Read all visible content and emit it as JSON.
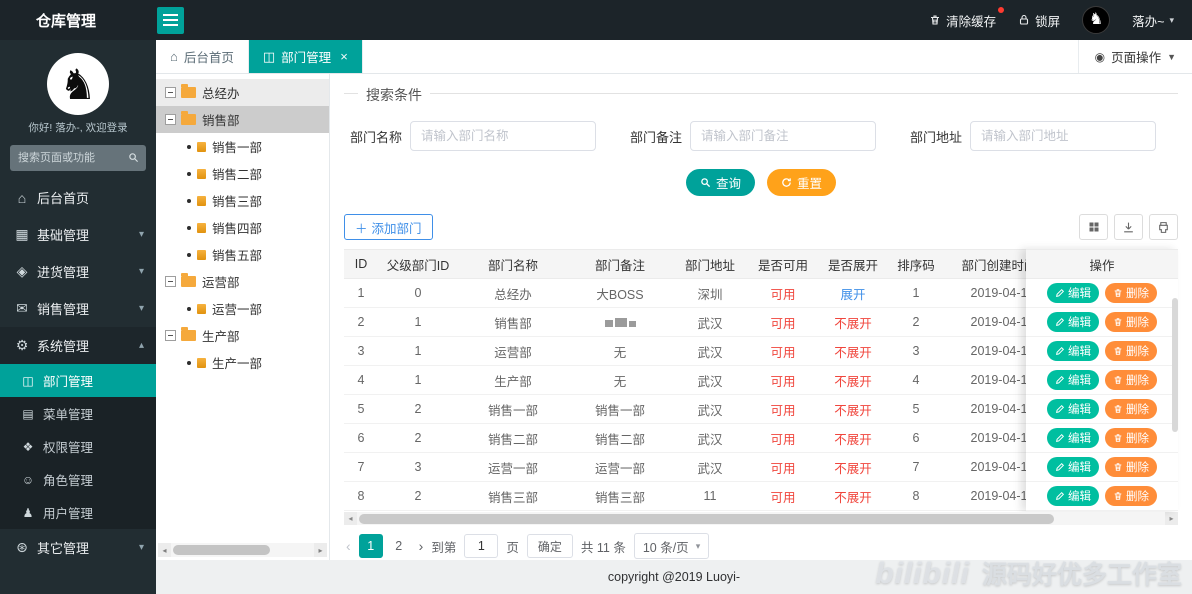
{
  "colors": {
    "teal": "#00a29a",
    "orange": "#ffa21a",
    "edit_teal": "#00bfa0",
    "delete_orange": "#ff8d39",
    "red": "#f0453c",
    "blue": "#3f8fe8"
  },
  "topbar": {
    "title": "仓库管理",
    "clear_cache": "清除缓存",
    "lock_screen": "锁屏",
    "user": "落办~"
  },
  "sidebar": {
    "greeting": "你好! 落办-, 欢迎登录",
    "search_placeholder": "搜索页面或功能",
    "menu": [
      {
        "key": "home",
        "label": "后台首页",
        "icon": "home-icon",
        "glyph": "⌂"
      },
      {
        "key": "basic",
        "label": "基础管理",
        "icon": "grid-icon",
        "glyph": "▦",
        "arrow": "down"
      },
      {
        "key": "purchase",
        "label": "进货管理",
        "icon": "purchase-icon",
        "glyph": "◈",
        "arrow": "down"
      },
      {
        "key": "sales",
        "label": "销售管理",
        "icon": "message-icon",
        "glyph": "✉",
        "arrow": "down"
      },
      {
        "key": "system",
        "label": "系统管理",
        "icon": "gear-icon",
        "glyph": "⚙",
        "arrow": "up",
        "expanded": true,
        "children": [
          {
            "key": "department",
            "label": "部门管理",
            "icon": "department-icon",
            "glyph": "◫",
            "active": true
          },
          {
            "key": "menu",
            "label": "菜单管理",
            "icon": "menu-icon",
            "glyph": "▤"
          },
          {
            "key": "permission",
            "label": "权限管理",
            "icon": "permission-icon",
            "glyph": "❖"
          },
          {
            "key": "role",
            "label": "角色管理",
            "icon": "role-icon",
            "glyph": "☺"
          },
          {
            "key": "user",
            "label": "用户管理",
            "icon": "user-icon",
            "glyph": "♟"
          }
        ]
      },
      {
        "key": "other",
        "label": "其它管理",
        "icon": "globe-icon",
        "glyph": "⊛",
        "arrow": "down"
      }
    ]
  },
  "tabs": {
    "items": [
      {
        "key": "home",
        "label": "后台首页",
        "glyph": "⌂",
        "active": false
      },
      {
        "key": "department",
        "label": "部门管理",
        "glyph": "◫",
        "active": true,
        "closable": true
      }
    ],
    "page_actions": "页面操作"
  },
  "tree": {
    "nodes": [
      {
        "label": "总经办",
        "type": "folder",
        "shaded": true
      },
      {
        "label": "销售部",
        "type": "folder",
        "selected": true
      },
      {
        "label": "销售一部",
        "type": "leaf"
      },
      {
        "label": "销售二部",
        "type": "leaf"
      },
      {
        "label": "销售三部",
        "type": "leaf"
      },
      {
        "label": "销售四部",
        "type": "leaf"
      },
      {
        "label": "销售五部",
        "type": "leaf"
      },
      {
        "label": "运营部",
        "type": "folder"
      },
      {
        "label": "运营一部",
        "type": "leaf"
      },
      {
        "label": "生产部",
        "type": "folder"
      },
      {
        "label": "生产一部",
        "type": "leaf"
      }
    ]
  },
  "search": {
    "title": "搜索条件",
    "fields": [
      {
        "label": "部门名称",
        "placeholder": "请输入部门名称"
      },
      {
        "label": "部门备注",
        "placeholder": "请输入部门备注"
      },
      {
        "label": "部门地址",
        "placeholder": "请输入部门地址"
      }
    ],
    "query_button": "查询",
    "reset_button": "重置"
  },
  "table": {
    "add_button": "添加部门",
    "headers": [
      "ID",
      "父级部门ID",
      "部门名称",
      "部门备注",
      "部门地址",
      "是否可用",
      "是否展开",
      "排序码",
      "部门创建时间",
      "操作"
    ],
    "edit_label": "编辑",
    "delete_label": "删除",
    "rows": [
      {
        "id": "1",
        "parent_id": "0",
        "name": "总经办",
        "remark": "大BOSS",
        "address": "深圳",
        "usable": "可用",
        "expand": "展开",
        "sort": "1",
        "created": "2019-04-1"
      },
      {
        "id": "2",
        "parent_id": "1",
        "name": "销售部",
        "remark": "",
        "remark_masked": true,
        "address": "武汉",
        "usable": "可用",
        "expand": "不展开",
        "sort": "2",
        "created": "2019-04-1"
      },
      {
        "id": "3",
        "parent_id": "1",
        "name": "运营部",
        "remark": "无",
        "address": "武汉",
        "usable": "可用",
        "expand": "不展开",
        "sort": "3",
        "created": "2019-04-1"
      },
      {
        "id": "4",
        "parent_id": "1",
        "name": "生产部",
        "remark": "无",
        "address": "武汉",
        "usable": "可用",
        "expand": "不展开",
        "sort": "4",
        "created": "2019-04-1"
      },
      {
        "id": "5",
        "parent_id": "2",
        "name": "销售一部",
        "remark": "销售一部",
        "address": "武汉",
        "usable": "可用",
        "expand": "不展开",
        "sort": "5",
        "created": "2019-04-1"
      },
      {
        "id": "6",
        "parent_id": "2",
        "name": "销售二部",
        "remark": "销售二部",
        "address": "武汉",
        "usable": "可用",
        "expand": "不展开",
        "sort": "6",
        "created": "2019-04-1"
      },
      {
        "id": "7",
        "parent_id": "3",
        "name": "运营一部",
        "remark": "运营一部",
        "address": "武汉",
        "usable": "可用",
        "expand": "不展开",
        "sort": "7",
        "created": "2019-04-1"
      },
      {
        "id": "8",
        "parent_id": "2",
        "name": "销售三部",
        "remark": "销售三部",
        "address": "11",
        "usable": "可用",
        "expand": "不展开",
        "sort": "8",
        "created": "2019-04-1"
      }
    ]
  },
  "pagination": {
    "pages": [
      "1",
      "2"
    ],
    "current": "1",
    "goto_label": "到第",
    "goto_value": "1",
    "page_label": "页",
    "confirm": "确定",
    "total": "共 11 条",
    "page_size": "10 条/页"
  },
  "footer": {
    "copyright": "copyright @2019 Luoyi-",
    "watermark_brand": "bilibili",
    "watermark_text": "源码好优多工作室"
  }
}
